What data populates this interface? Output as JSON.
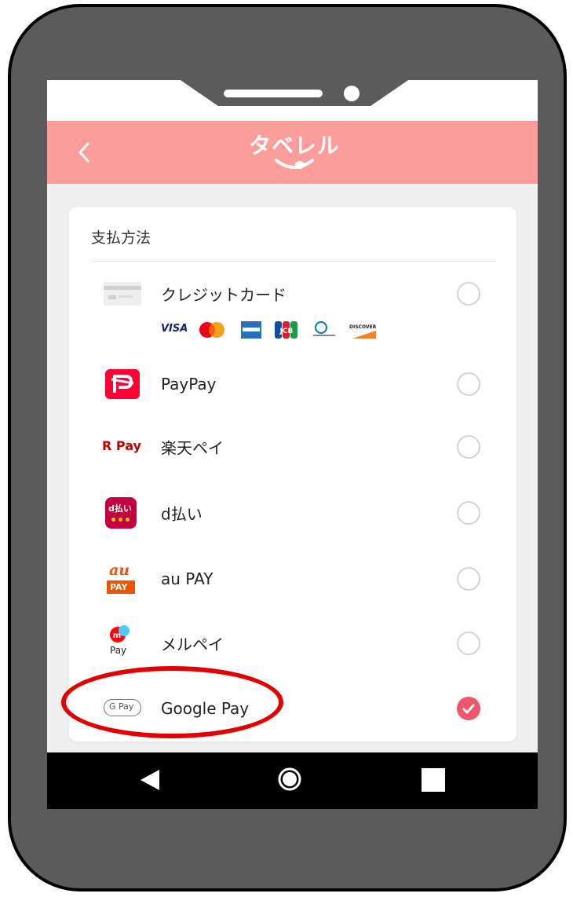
{
  "app": {
    "logo_text": "タベレル"
  },
  "payment": {
    "title": "支払方法",
    "options": [
      {
        "label": "クレジットカード",
        "icon": "credit-card-icon",
        "selected": false
      },
      {
        "label": "PayPay",
        "icon": "paypay-icon",
        "selected": false
      },
      {
        "label": "楽天ペイ",
        "icon": "rakuten-pay-icon",
        "icon_text": "R Pay",
        "selected": false
      },
      {
        "label": "d払い",
        "icon": "d-barai-icon",
        "icon_text": "d払い",
        "selected": false
      },
      {
        "label": "au PAY",
        "icon": "au-pay-icon",
        "icon_text_top": "au",
        "icon_text_bottom": "PAY",
        "selected": false
      },
      {
        "label": "メルペイ",
        "icon": "merpay-icon",
        "icon_text": "Pay",
        "selected": false
      },
      {
        "label": "Google Pay",
        "icon": "google-pay-icon",
        "icon_text": "G Pay",
        "selected": true
      }
    ],
    "card_brands": {
      "visa": "VISA",
      "amex": "AMERICAN EXPRESS",
      "jcb": "JCB",
      "diners": "Diners Club",
      "discover": "DISCOVER"
    }
  },
  "colors": {
    "header": "#fb9d9b",
    "accent": "#f0566b",
    "highlight": "#e50000",
    "phone_body": "#5b5b5b"
  },
  "navigation": {
    "back": "back-icon",
    "home": "home-icon",
    "recents": "recents-icon"
  }
}
